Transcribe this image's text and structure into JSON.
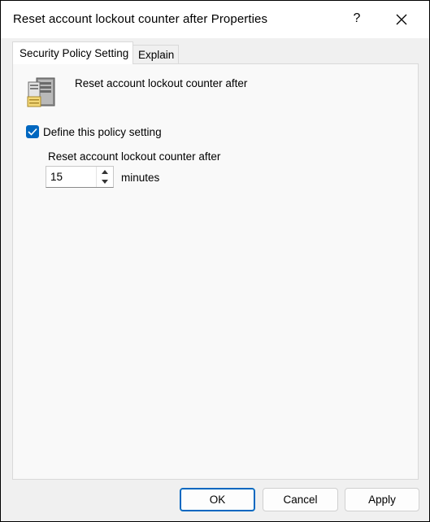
{
  "window": {
    "title": "Reset account lockout counter after Properties",
    "help_label": "?"
  },
  "tabs": [
    {
      "label": "Security Policy Setting",
      "active": true
    },
    {
      "label": "Explain",
      "active": false
    }
  ],
  "policy": {
    "icon": "server-policy-icon",
    "name": "Reset account lockout counter after"
  },
  "define_setting": {
    "label": "Define this policy setting",
    "checked": true
  },
  "counter": {
    "label": "Reset account lockout counter after",
    "value": "15",
    "unit": "minutes"
  },
  "buttons": {
    "ok": "OK",
    "cancel": "Cancel",
    "apply": "Apply"
  },
  "colors": {
    "accent": "#0067c0",
    "panel": "#f9f9f9",
    "chrome": "#f0f0f0"
  }
}
